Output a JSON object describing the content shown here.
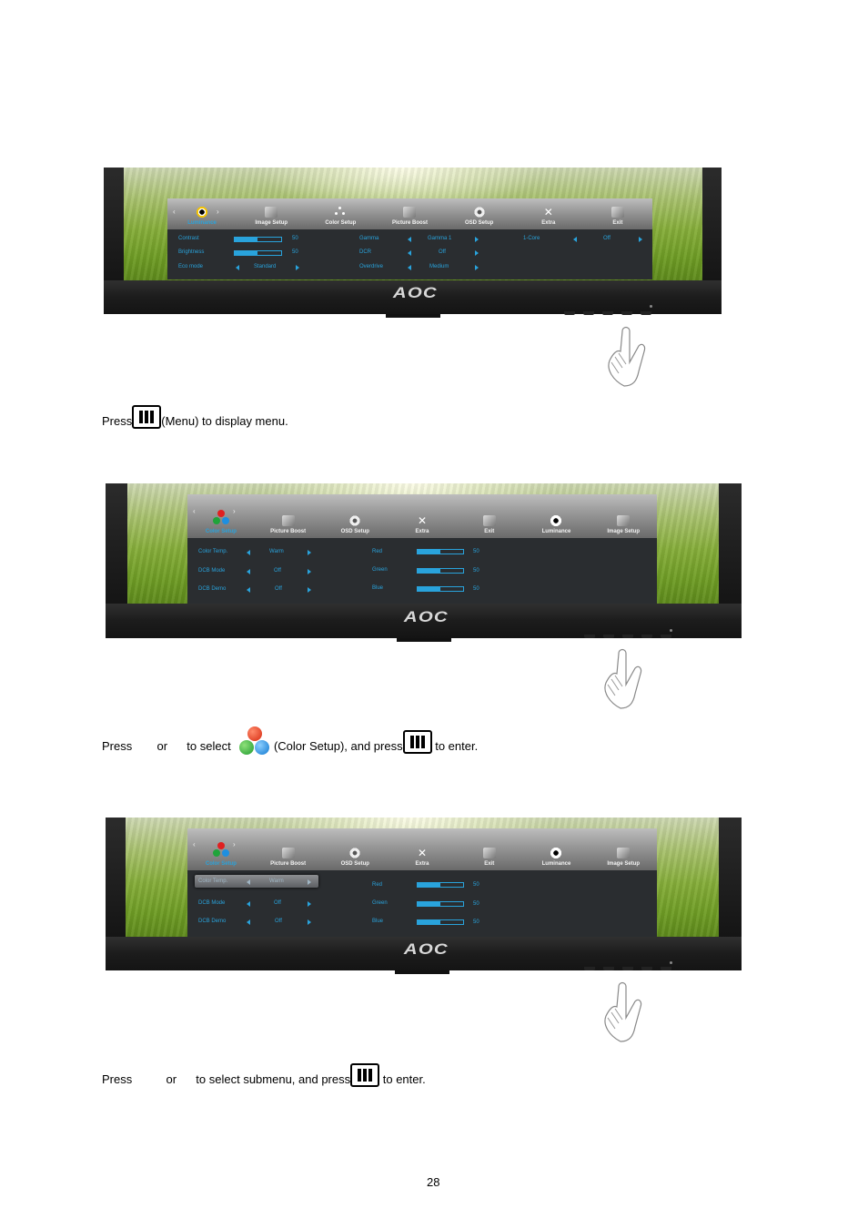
{
  "figures": [
    {
      "brand_logo": "AOC",
      "osd": {
        "tabs": [
          {
            "label": "Luminance",
            "icon": "sun-contrast-icon",
            "active": true
          },
          {
            "label": "Image Setup",
            "icon": "image-setup-icon"
          },
          {
            "label": "Color Setup",
            "icon": "color-setup-icon"
          },
          {
            "label": "Picture Boost",
            "icon": "picture-boost-icon"
          },
          {
            "label": "OSD Setup",
            "icon": "osd-setup-icon"
          },
          {
            "label": "Extra",
            "icon": "extra-tools-icon"
          },
          {
            "label": "Exit",
            "icon": "exit-door-icon"
          }
        ],
        "rows": [
          {
            "label": "Contrast",
            "type": "slider",
            "value": 50,
            "value_text": "50"
          },
          {
            "label": "Brightness",
            "type": "slider",
            "value": 50,
            "value_text": "50"
          },
          {
            "label": "Eco mode",
            "type": "select",
            "value_text": "Standard"
          },
          {
            "label": "Gamma",
            "type": "select",
            "value_text": "Gamma 1"
          },
          {
            "label": "DCR",
            "type": "select",
            "value_text": "Off"
          },
          {
            "label": "Overdrive",
            "type": "select",
            "value_text": "Medium"
          },
          {
            "label": "1-Core",
            "type": "select",
            "value_text": "Off"
          }
        ]
      }
    },
    {
      "brand_logo": "AOC",
      "osd": {
        "tabs": [
          {
            "label": "Color Setup",
            "icon": "color-setup-icon",
            "active": true
          },
          {
            "label": "Picture Boost",
            "icon": "picture-boost-icon"
          },
          {
            "label": "OSD Setup",
            "icon": "osd-setup-icon"
          },
          {
            "label": "Extra",
            "icon": "extra-tools-icon"
          },
          {
            "label": "Exit",
            "icon": "exit-door-icon"
          },
          {
            "label": "Luminance",
            "icon": "sun-contrast-icon"
          },
          {
            "label": "Image Setup",
            "icon": "image-setup-icon"
          }
        ],
        "rows": [
          {
            "label": "Color Temp.",
            "type": "select",
            "value_text": "Warm"
          },
          {
            "label": "DCB Mode",
            "type": "select",
            "value_text": "Off"
          },
          {
            "label": "DCB Demo",
            "type": "select",
            "value_text": "Off"
          },
          {
            "label": "Red",
            "type": "slider",
            "value": 50,
            "value_text": "50"
          },
          {
            "label": "Green",
            "type": "slider",
            "value": 50,
            "value_text": "50"
          },
          {
            "label": "Blue",
            "type": "slider",
            "value": 50,
            "value_text": "50"
          }
        ]
      }
    },
    {
      "brand_logo": "AOC",
      "osd": {
        "highlighted_row": "Color Temp.",
        "tabs": [
          {
            "label": "Color Setup",
            "icon": "color-setup-icon",
            "active": true
          },
          {
            "label": "Picture Boost",
            "icon": "picture-boost-icon"
          },
          {
            "label": "OSD Setup",
            "icon": "osd-setup-icon"
          },
          {
            "label": "Extra",
            "icon": "extra-tools-icon"
          },
          {
            "label": "Exit",
            "icon": "exit-door-icon"
          },
          {
            "label": "Luminance",
            "icon": "sun-contrast-icon"
          },
          {
            "label": "Image Setup",
            "icon": "image-setup-icon"
          }
        ],
        "rows": [
          {
            "label": "Color Temp.",
            "type": "select",
            "value_text": "Warm"
          },
          {
            "label": "DCB Mode",
            "type": "select",
            "value_text": "Off"
          },
          {
            "label": "DCB Demo",
            "type": "select",
            "value_text": "Off"
          },
          {
            "label": "Red",
            "type": "slider",
            "value": 50,
            "value_text": "50"
          },
          {
            "label": "Green",
            "type": "slider",
            "value": 50,
            "value_text": "50"
          },
          {
            "label": "Blue",
            "type": "slider",
            "value": 50,
            "value_text": "50"
          }
        ]
      }
    }
  ],
  "captions": [
    {
      "before": "Press",
      "after": "(Menu) to display menu."
    },
    {
      "press": "Press",
      "or": "or",
      "to_select": "to select",
      "selection": "(Color Setup), and press",
      "end": "to enter."
    },
    {
      "press": "Press",
      "or": "or",
      "middle": "to select submenu, and press",
      "end": "to enter."
    }
  ],
  "page_number": "28",
  "colors": {
    "osd_accent": "#29a3dc",
    "osd_body": "#2a2d30"
  }
}
